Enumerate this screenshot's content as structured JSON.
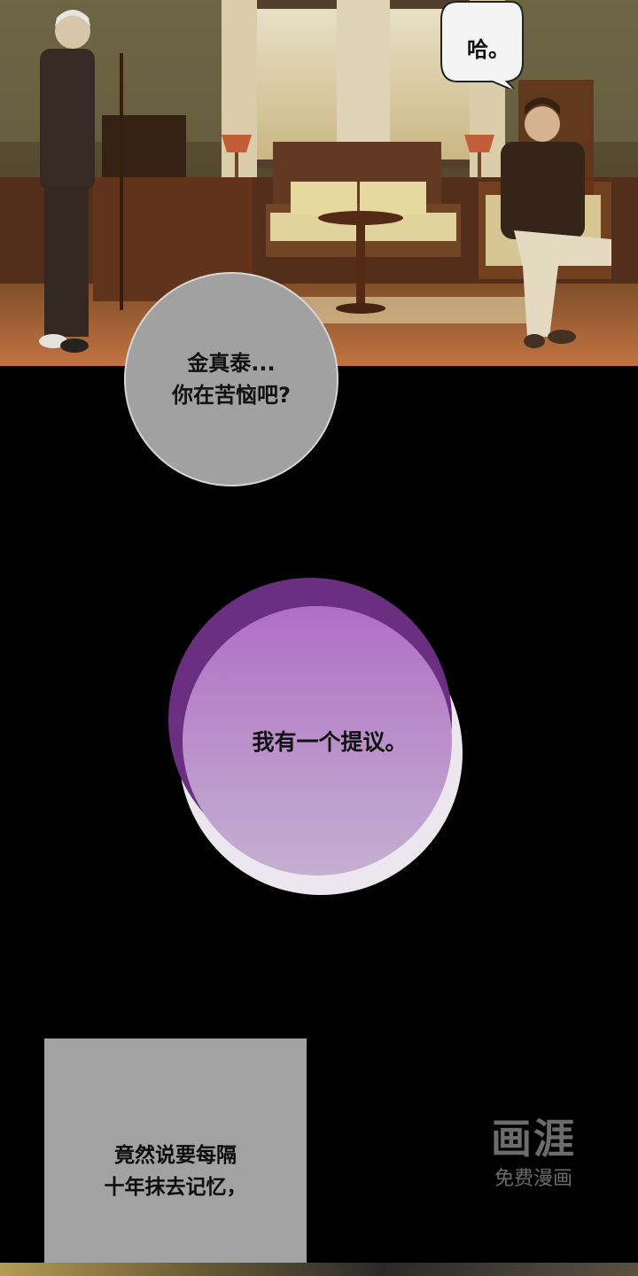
{
  "scene": {
    "description_icon": "bedroom-scene-illustration"
  },
  "bubbles": {
    "top_right": "哈。",
    "grey_circle": [
      "金真泰...",
      "你在苦恼吧?"
    ],
    "purple_orb": "我有一个提议。",
    "grey_box": [
      "竟然说要每隔",
      "十年抹去记忆，"
    ]
  },
  "watermark": {
    "logo": "画涯",
    "sub": "免费漫画"
  },
  "colors": {
    "background": "#000000",
    "orb_purple": "#9b5fb5",
    "bubble_grey": "#a1a1a1"
  }
}
